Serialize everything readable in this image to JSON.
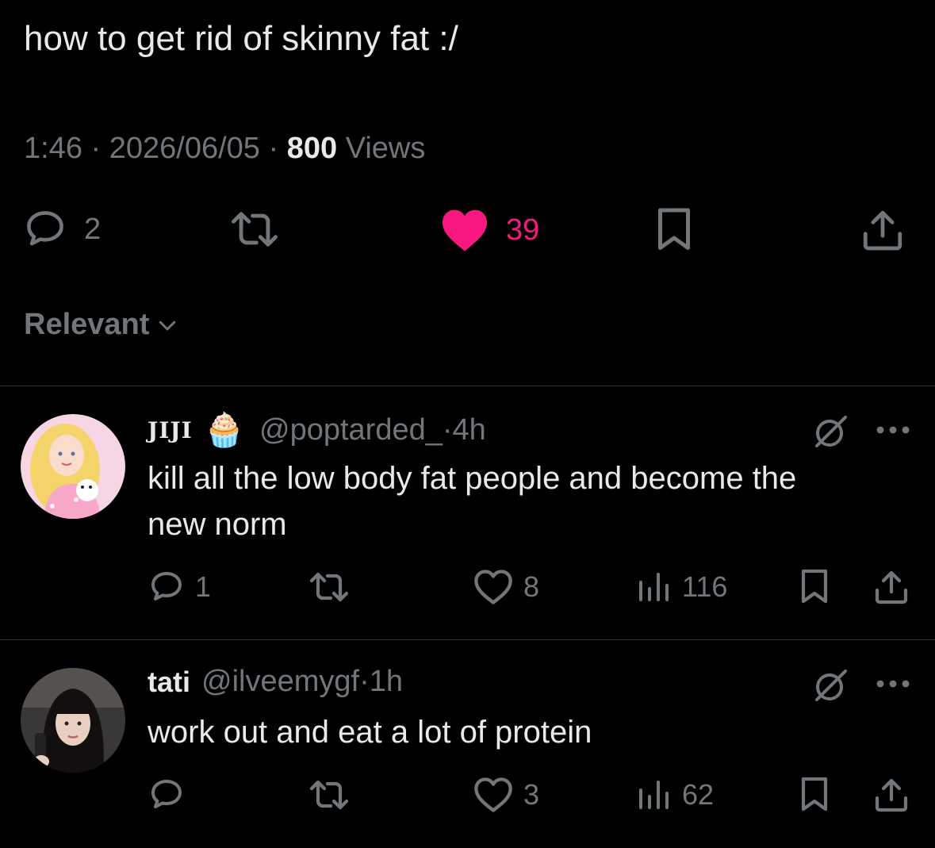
{
  "post": {
    "text": "how to get rid of skinny fat :/",
    "time": "1:46",
    "date": "2026/06/05",
    "views_count": "800",
    "views_label": "Views",
    "replies": "2",
    "likes": "39",
    "like_color": "#f91880"
  },
  "sort": {
    "label": "Relevant"
  },
  "replies": [
    {
      "name": "JIJI",
      "emoji": "🧁",
      "handle": "@poptarded_",
      "time": "4h",
      "text_line1": "kill all the low body fat people and become the",
      "text_line2": "new norm",
      "replies": "1",
      "likes": "8",
      "views": "116"
    },
    {
      "name": "tati",
      "handle": "@ilveemygf",
      "time": "1h",
      "text_line1": "work out and eat a lot of protein",
      "replies": "",
      "likes": "3",
      "views": "62"
    }
  ],
  "icons": {
    "reply": "speech-bubble-icon",
    "repost": "repost-icon",
    "like": "heart-icon",
    "views": "bar-chart-icon",
    "bookmark": "bookmark-icon",
    "share": "share-icon",
    "grok": "grok-icon",
    "more": "more-dots-icon"
  },
  "colors": {
    "background": "#000000",
    "text": "#e7e9ea",
    "muted": "#71767b",
    "accent_like": "#f91880"
  }
}
